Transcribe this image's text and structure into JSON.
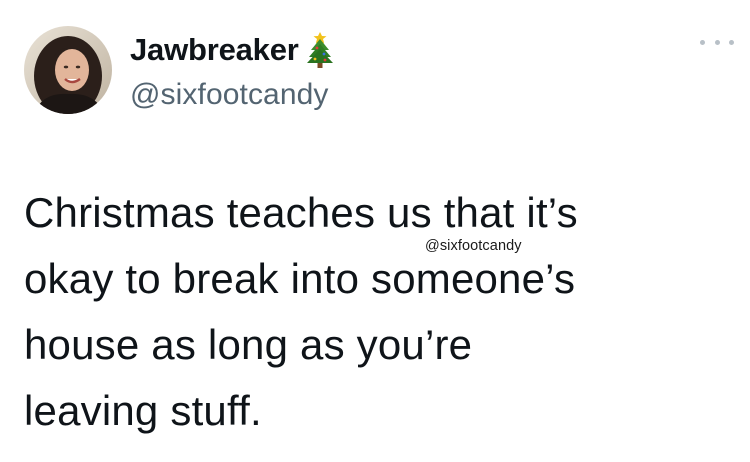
{
  "author": {
    "display_name": "Jawbreaker",
    "handle": "@sixfootcandy",
    "name_emoji": "christmas-tree-icon"
  },
  "tweet": {
    "lines": [
      "Christmas teaches us that it’s",
      "okay to break into someone’s",
      "house as long as you’re",
      "leaving stuff."
    ]
  },
  "watermark": "@sixfootcandy",
  "colors": {
    "text": "#0f1419",
    "handle": "#536471",
    "more_dots": "#b8c0c7",
    "background": "#ffffff"
  }
}
